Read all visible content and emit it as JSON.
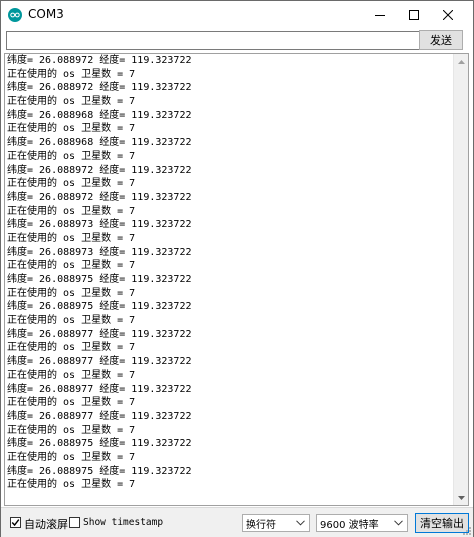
{
  "window": {
    "title": "COM3",
    "colors": {
      "app_icon": "#00979c",
      "accent_border": "#0078d7"
    }
  },
  "sendbar": {
    "input_value": "",
    "send_label": "发送"
  },
  "console": {
    "lines": [
      "纬度= 26.088972 经度= 119.323722",
      "正在使用的 os 卫星数 = 7",
      "纬度= 26.088972 经度= 119.323722",
      "正在使用的 os 卫星数 = 7",
      "纬度= 26.088968 经度= 119.323722",
      "正在使用的 os 卫星数 = 7",
      "纬度= 26.088968 经度= 119.323722",
      "正在使用的 os 卫星数 = 7",
      "纬度= 26.088972 经度= 119.323722",
      "正在使用的 os 卫星数 = 7",
      "纬度= 26.088972 经度= 119.323722",
      "正在使用的 os 卫星数 = 7",
      "纬度= 26.088973 经度= 119.323722",
      "正在使用的 os 卫星数 = 7",
      "纬度= 26.088973 经度= 119.323722",
      "正在使用的 os 卫星数 = 7",
      "纬度= 26.088975 经度= 119.323722",
      "正在使用的 os 卫星数 = 7",
      "纬度= 26.088975 经度= 119.323722",
      "正在使用的 os 卫星数 = 7",
      "纬度= 26.088977 经度= 119.323722",
      "正在使用的 os 卫星数 = 7",
      "纬度= 26.088977 经度= 119.323722",
      "正在使用的 os 卫星数 = 7",
      "纬度= 26.088977 经度= 119.323722",
      "正在使用的 os 卫星数 = 7",
      "纬度= 26.088977 经度= 119.323722",
      "正在使用的 os 卫星数 = 7",
      "纬度= 26.088975 经度= 119.323722",
      "正在使用的 os 卫星数 = 7",
      "纬度= 26.088975 经度= 119.323722",
      "正在使用的 os 卫星数 = 7"
    ]
  },
  "bottombar": {
    "autoscroll_label": "自动滚屏",
    "autoscroll_checked": true,
    "timestamp_label": "Show timestamp",
    "timestamp_checked": false,
    "line_ending_value": "换行符",
    "baud_value": "9600 波特率",
    "clear_label": "清空输出"
  },
  "icons": {
    "app": "arduino-icon",
    "minimize": "minimize-icon",
    "maximize": "maximize-icon",
    "close": "close-icon",
    "checkmark": "checkmark-icon",
    "dropdown": "chevron-down-icon",
    "scroll_up": "scroll-up-arrow-icon",
    "scroll_down": "scroll-down-arrow-icon"
  }
}
